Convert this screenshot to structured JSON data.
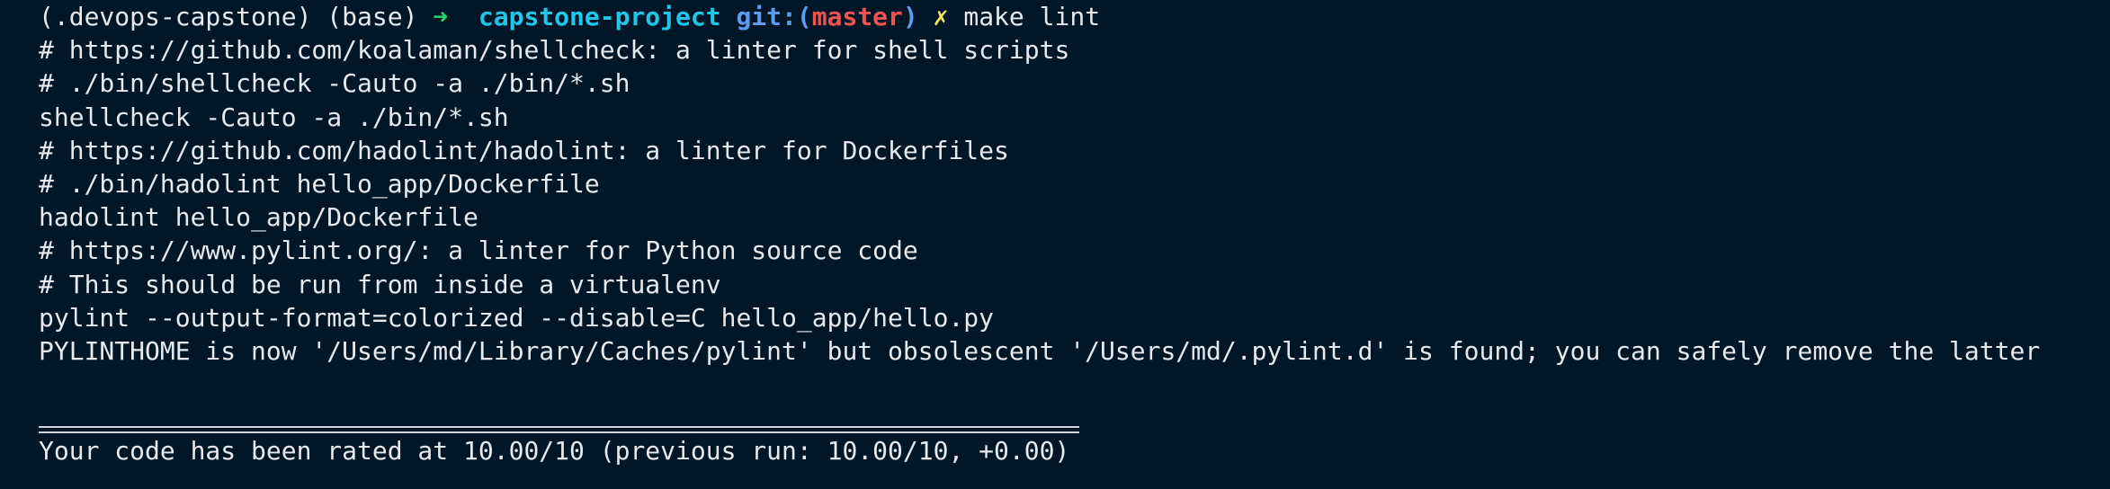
{
  "prompt": {
    "env": "(.devops-capstone) (base)",
    "arrow": "➜",
    "directory": "capstone-project",
    "git_label": "git:(",
    "branch": "master",
    "git_close": ")",
    "dirty_mark": "✗",
    "command": "make lint"
  },
  "output": [
    "# https://github.com/koalaman/shellcheck: a linter for shell scripts",
    "# ./bin/shellcheck -Cauto -a ./bin/*.sh",
    "shellcheck -Cauto -a ./bin/*.sh",
    "# https://github.com/hadolint/hadolint: a linter for Dockerfiles",
    "# ./bin/hadolint hello_app/Dockerfile",
    "hadolint hello_app/Dockerfile",
    "# https://www.pylint.org/: a linter for Python source code",
    "# This should be run from inside a virtualenv",
    "pylint --output-format=colorized --disable=C hello_app/hello.py",
    "PYLINTHOME is now '/Users/md/Library/Caches/pylint' but obsolescent '/Users/md/.pylint.d' is found; you can safely remove the latter"
  ],
  "rating": "Your code has been rated at 10.00/10 (previous run: 10.00/10, +0.00)",
  "colors": {
    "background": "#011627",
    "text": "#e6e9ee",
    "arrow": "#22da6e",
    "directory": "#21c7e8",
    "git": "#5c9df0",
    "branch": "#ef5350",
    "dirty": "#f5e55b"
  }
}
